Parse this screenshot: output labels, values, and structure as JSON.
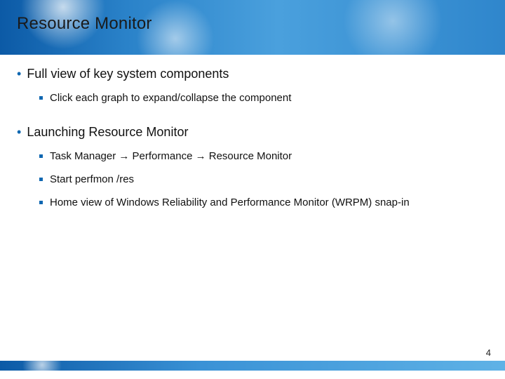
{
  "title": "Resource Monitor",
  "bullets": {
    "b1": "Full view of key system components",
    "b1_1": "Click each graph to expand/collapse the component",
    "b2": "Launching Resource Monitor",
    "b2_1": "Task Manager → Performance → Resource Monitor",
    "b2_2": "Start perfmon /res",
    "b2_3": "Home view of Windows Reliability and Performance Monitor (WRPM) snap-in"
  },
  "page_number": "4"
}
